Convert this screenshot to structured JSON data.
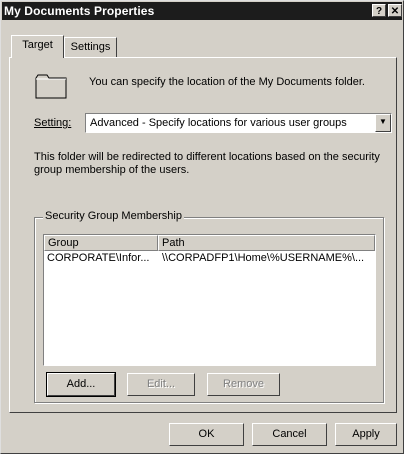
{
  "window": {
    "title": "My Documents Properties",
    "help_label": "?",
    "close_label": "✕"
  },
  "tabs": [
    {
      "label": "Target"
    },
    {
      "label": "Settings"
    }
  ],
  "intro_text": "You can specify the location of the My Documents folder.",
  "setting": {
    "label": "Setting:",
    "value": "Advanced - Specify locations for various user groups"
  },
  "description": {
    "line1": "This folder will be redirected to different locations based on the security",
    "line2": "group membership of the users."
  },
  "security_group": {
    "legend": "Security Group Membership",
    "columns": [
      "Group",
      "Path"
    ],
    "rows": [
      {
        "group": "CORPORATE\\Infor...",
        "path": "\\\\CORPADFP1\\Home\\%USERNAME%\\..."
      }
    ]
  },
  "group_buttons": {
    "add": "Add...",
    "edit": "Edit...",
    "remove": "Remove"
  },
  "footer_buttons": {
    "ok": "OK",
    "cancel": "Cancel",
    "apply": "Apply"
  }
}
